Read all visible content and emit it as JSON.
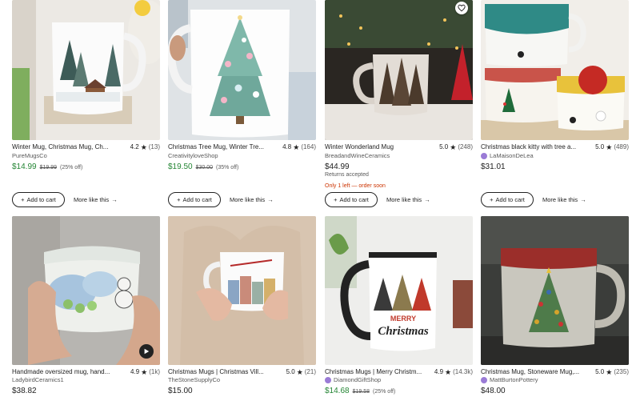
{
  "listings": [
    {
      "title": "Winter Mug, Christmas Mug, Ch...",
      "rating": "4.2",
      "reviews": "(13)",
      "shop": "PureMugsCo",
      "price": "$14.99",
      "original_price": "$19.99",
      "discount": "(25% off)",
      "add_to_cart": "Add to cart",
      "more_like_this": "More like this"
    },
    {
      "title": "Christmas Tree Mug, Winter Tre...",
      "rating": "4.8",
      "reviews": "(164)",
      "shop": "CreativityloveShop",
      "price": "$19.50",
      "original_price": "$30.00",
      "discount": "(35% off)",
      "add_to_cart": "Add to cart",
      "more_like_this": "More like this"
    },
    {
      "title": "Winter Wonderland Mug",
      "rating": "5.0",
      "reviews": "(248)",
      "shop": "BreadandWineCeramics",
      "price": "$44.99",
      "note1": "Returns accepted",
      "note2": "Only 1 left — order soon",
      "add_to_cart": "Add to cart",
      "more_like_this": "More like this"
    },
    {
      "title": "Christmas black kitty with tree a...",
      "rating": "5.0",
      "reviews": "(489)",
      "shop": "LaMaisonDeLea",
      "price": "$31.01",
      "add_to_cart": "Add to cart",
      "more_like_this": "More like this"
    },
    {
      "title": "Handmade oversized mug, hand...",
      "rating": "4.9",
      "reviews": "(1k)",
      "shop": "LadybirdCeramics1",
      "price": "$38.82"
    },
    {
      "title": "Christmas Mugs | Christmas Vill...",
      "rating": "5.0",
      "reviews": "(21)",
      "shop": "TheStoneSupplyCo",
      "price": "$15.00"
    },
    {
      "title": "Christmas Mugs | Merry Christm...",
      "rating": "4.9",
      "reviews": "(14.3k)",
      "shop": "DiamondGiftShop",
      "price": "$14.68",
      "original_price": "$19.58",
      "discount": "(25% off)",
      "mug_text_1": "MERRY",
      "mug_text_2": "Christmas"
    },
    {
      "title": "Christmas Mug, Stoneware Mug,...",
      "rating": "5.0",
      "reviews": "(235)",
      "shop": "MattBurtonPottery",
      "price": "$48.00"
    }
  ],
  "colors": {
    "sale_price": "#258635",
    "warning": "#cc3300",
    "star_seller_badge": "#9a7bd6"
  }
}
